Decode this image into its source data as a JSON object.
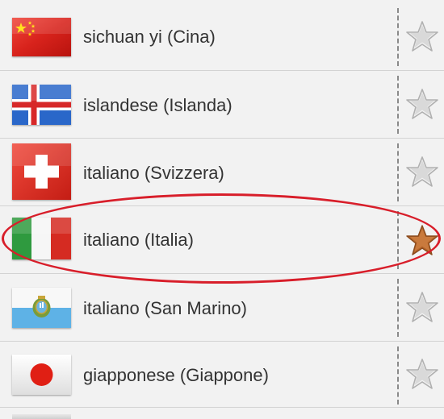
{
  "languages": [
    {
      "label": "sichuan yi (Cina)",
      "flag_icon": "china-flag-icon",
      "favorite": false
    },
    {
      "label": "islandese (Islanda)",
      "flag_icon": "iceland-flag-icon",
      "favorite": false
    },
    {
      "label": "italiano (Svizzera)",
      "flag_icon": "switzerland-flag-icon",
      "favorite": false
    },
    {
      "label": "italiano (Italia)",
      "flag_icon": "italy-flag-icon",
      "favorite": true
    },
    {
      "label": "italiano (San Marino)",
      "flag_icon": "san-marino-flag-icon",
      "favorite": false
    },
    {
      "label": "giapponese (Giappone)",
      "flag_icon": "japan-flag-icon",
      "favorite": false
    }
  ],
  "colors": {
    "favorite_star": "#b5652a",
    "inactive_star": "#c8c8c8",
    "highlight_ellipse": "#d81e2a",
    "text": "#333333"
  }
}
